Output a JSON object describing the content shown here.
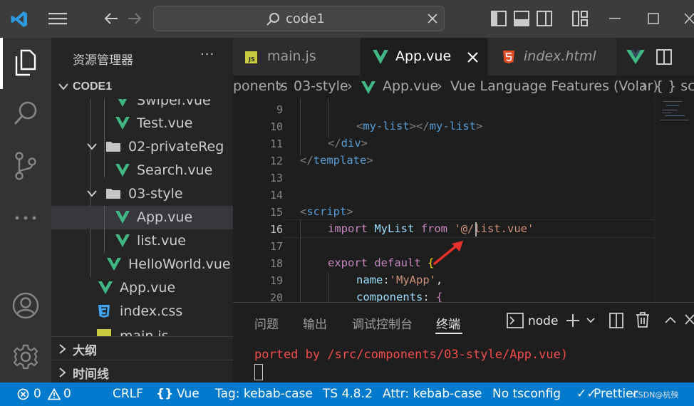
{
  "title_bar": {
    "search_text": "code1",
    "icons": [
      "vscode-logo-icon",
      "menu-icon",
      "back-arrow-icon",
      "forward-arrow-icon",
      "search-icon",
      "close-icon",
      "toggle-primary-sidebar-icon",
      "toggle-panel-icon",
      "toggle-secondary-sidebar-icon",
      "customize-layout-icon",
      "minimize-icon",
      "maximize-icon",
      "close-window-icon"
    ]
  },
  "activity_bar": {
    "items": [
      "explorer-icon",
      "search-icon",
      "source-control-icon",
      "more-icon",
      "account-icon",
      "settings-gear-icon"
    ]
  },
  "sidebar": {
    "title": "资源管理器",
    "more": "···",
    "root": "CODE1",
    "tree": [
      {
        "label": "Swiper.vue",
        "kind": "vue"
      },
      {
        "label": "Test.vue",
        "kind": "vue"
      },
      {
        "label": "02-privateReg",
        "kind": "folder"
      },
      {
        "label": "Search.vue",
        "kind": "vue"
      },
      {
        "label": "03-style",
        "kind": "folder"
      },
      {
        "label": "App.vue",
        "kind": "vue",
        "selected": true
      },
      {
        "label": "list.vue",
        "kind": "vue"
      },
      {
        "label": "HelloWorld.vue",
        "kind": "vue"
      },
      {
        "label": "App.vue",
        "kind": "vue"
      },
      {
        "label": "index.css",
        "kind": "css"
      },
      {
        "label": "main.js",
        "kind": "js"
      }
    ],
    "outline": "大纲",
    "timeline": "时间线"
  },
  "tabs": [
    {
      "label": "main.js",
      "icon": "js-file-icon"
    },
    {
      "label": "App.vue",
      "icon": "vue-file-icon",
      "active": true
    },
    {
      "label": "index.html",
      "icon": "html-file-icon"
    }
  ],
  "breadcrumb": {
    "parts": [
      "ponents",
      "03-style",
      "App.vue",
      "Vue Language Features (Volar)",
      "{ } scri"
    ]
  },
  "editor": {
    "line_numbers": [
      "9",
      "10",
      "11",
      "12",
      "13",
      "14",
      "15",
      "16",
      "17",
      "18",
      "19",
      "20"
    ],
    "current_line": "16",
    "lines": {
      "l10_a": "<",
      "l10_b": "my-list",
      "l10_c": "></",
      "l10_d": "my-list",
      "l10_e": ">",
      "l11_a": "</",
      "l11_b": "div",
      "l11_c": ">",
      "l12_a": "</",
      "l12_b": "template",
      "l12_c": ">",
      "l15_a": "<",
      "l15_b": "script",
      "l15_c": ">",
      "l16_a": "import",
      "l16_b": "MyList",
      "l16_c": "from",
      "l16_d": "'@/list.vue'",
      "l18_a": "export",
      "l18_b": "default",
      "l18_c": "{",
      "l19_a": "name",
      "l19_b": ":",
      "l19_c": "'MyApp'",
      "l19_d": ",",
      "l20_a": "components",
      "l20_b": ":",
      "l20_c": "{"
    }
  },
  "panel": {
    "tabs": [
      "问题",
      "输出",
      "调试控制台",
      "终端"
    ],
    "active_tab": "终端",
    "terminal_name": "node",
    "terminal_text": "ported by /src/components/03-style/App.vue)"
  },
  "status_bar": {
    "errors": "0",
    "warnings": "0",
    "eol": "CRLF",
    "language": "Vue",
    "tag": "Tag: kebab-case",
    "ts": "TS 4.8.2",
    "attr": "Attr: kebab-case",
    "tsconfig": "No tsconfig",
    "prettier": "Prettier",
    "watermark": "CSDN@杭殃"
  },
  "colors": {
    "accent": "#007acc",
    "vue_green": "#41b883",
    "html_orange": "#e44d26",
    "css_blue": "#42a5f5",
    "js_yellow": "#cbcb41",
    "arrow_red": "#e5322d"
  }
}
